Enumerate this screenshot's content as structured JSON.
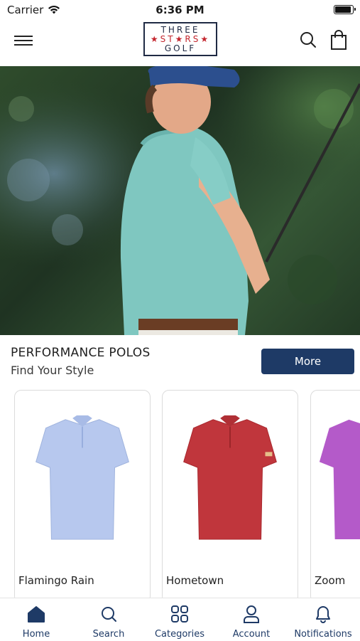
{
  "status_bar": {
    "carrier": "Carrier",
    "time": "6:36 PM"
  },
  "header": {
    "logo_top": "THREE",
    "logo_mid": "★ST★RS★",
    "logo_bottom": "GOLF"
  },
  "section": {
    "title": "PERFORMANCE POLOS",
    "subtitle": "Find Your Style",
    "more_label": "More"
  },
  "products": [
    {
      "name": "Flamingo Rain",
      "color": "#b7c8ee"
    },
    {
      "name": "Hometown",
      "color": "#c0363c"
    },
    {
      "name": "Zoom",
      "color": "#b45ac9"
    }
  ],
  "tabs": [
    {
      "label": "Home",
      "icon": "home-icon"
    },
    {
      "label": "Search",
      "icon": "search-icon"
    },
    {
      "label": "Categories",
      "icon": "grid-icon"
    },
    {
      "label": "Account",
      "icon": "user-icon"
    },
    {
      "label": "Notifications",
      "icon": "bell-icon"
    }
  ],
  "colors": {
    "accent": "#1e3a66",
    "logo_red": "#c4262e"
  }
}
